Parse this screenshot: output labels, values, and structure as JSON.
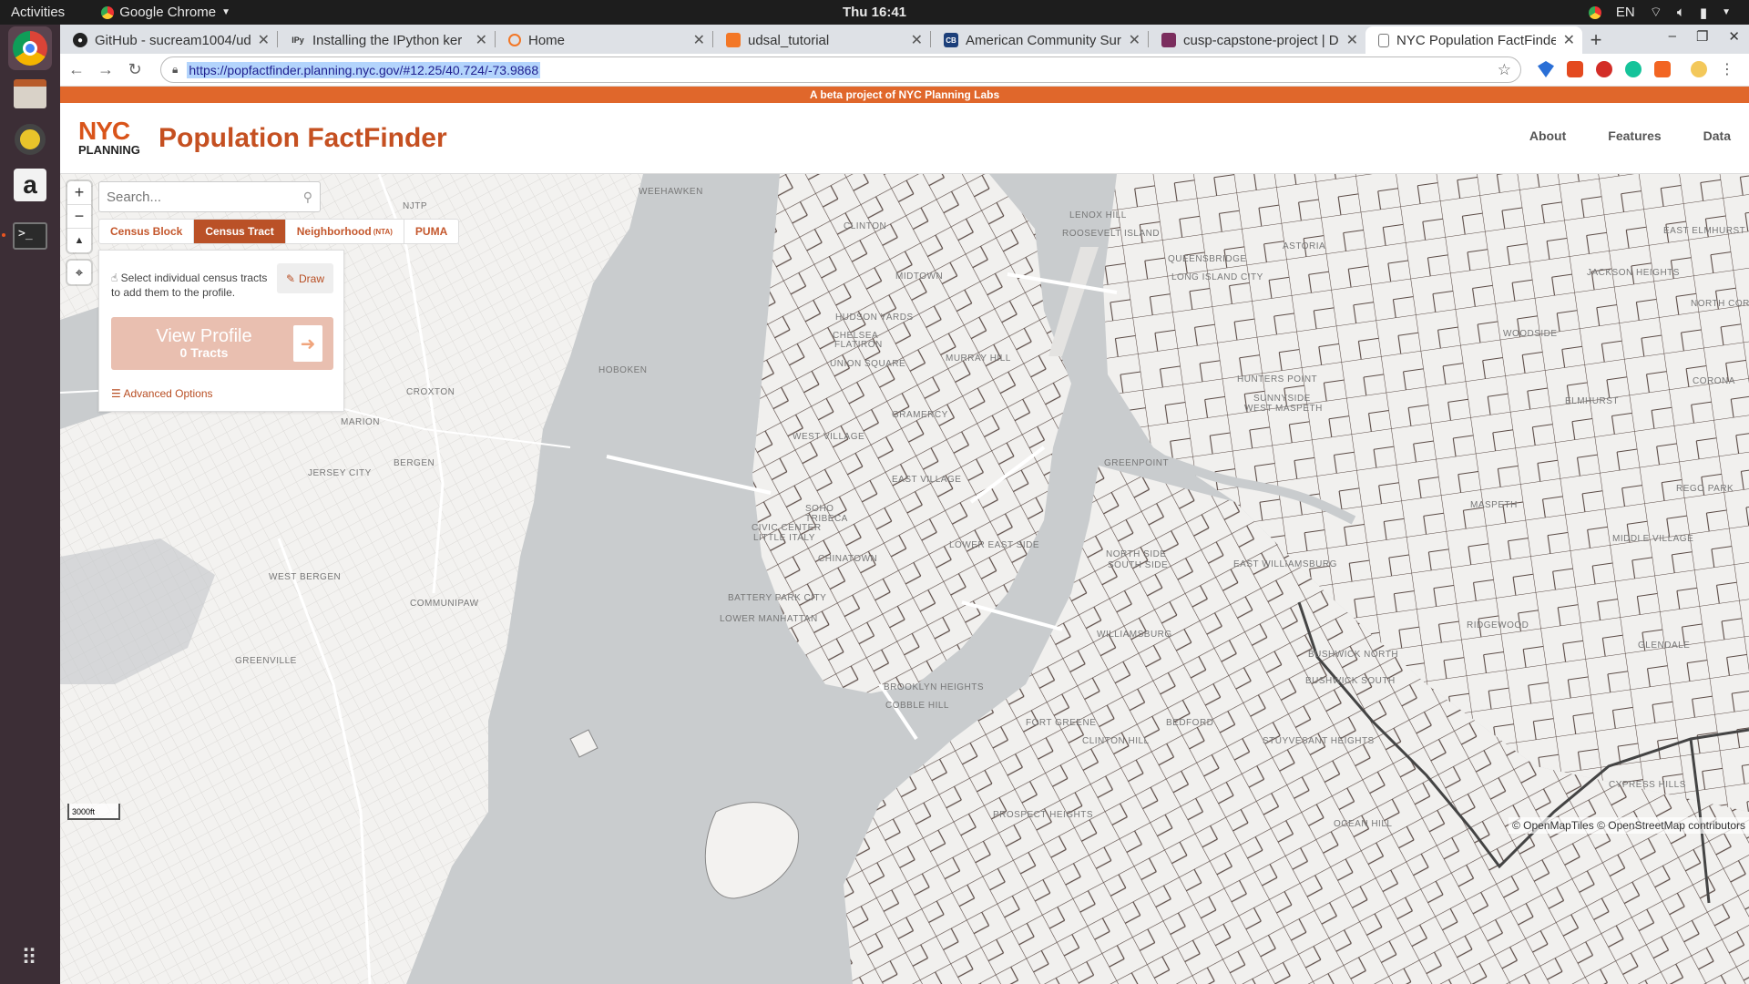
{
  "os": {
    "activities": "Activities",
    "app_name": "Google Chrome",
    "clock": "Thu 16:41",
    "lang": "EN"
  },
  "browser": {
    "tabs": [
      {
        "title": "GitHub - sucream1004/ud",
        "icon": "github-icon"
      },
      {
        "title": "Installing the IPython ker",
        "icon": "ipython-icon"
      },
      {
        "title": "Home",
        "icon": "jupyter-icon"
      },
      {
        "title": "udsal_tutorial",
        "icon": "notebook-icon"
      },
      {
        "title": "American Community Sur",
        "icon": "census-icon"
      },
      {
        "title": "cusp-capstone-project | D",
        "icon": "project-icon"
      },
      {
        "title": "NYC Population FactFinde",
        "icon": "page-icon"
      }
    ],
    "url": "https://popfactfinder.planning.nyc.gov/#12.25/40.724/-73.9868"
  },
  "site": {
    "beta_banner": "A beta project of NYC Planning Labs",
    "logo_top": "NYC",
    "logo_bottom": "PLANNING",
    "title": "Population FactFinder",
    "nav": [
      "About",
      "Features",
      "Data"
    ]
  },
  "controls": {
    "zoom_in": "+",
    "zoom_out": "−",
    "search_placeholder": "Search...",
    "geo_tabs": [
      {
        "label": "Census Block",
        "suffix": "",
        "active": false
      },
      {
        "label": "Census Tract",
        "suffix": "",
        "active": true
      },
      {
        "label": "Neighborhood",
        "suffix": "(NTA)",
        "active": false
      },
      {
        "label": "PUMA",
        "suffix": "",
        "active": false
      }
    ],
    "instructions": "Select individual census tracts to add them to the profile.",
    "draw_label": "Draw",
    "view_profile": "View Profile",
    "tract_count": "0 Tracts",
    "advanced": "Advanced Options"
  },
  "map": {
    "scale": "3000ft",
    "attribution": "© OpenMapTiles © OpenStreetMap contributors",
    "labels": [
      "WEEHAWKEN",
      "NJTP",
      "HOBOKEN",
      "JERSEY CITY",
      "BERGEN",
      "WEST BERGEN",
      "COMMUNIPAW",
      "GREENVILLE",
      "MARION",
      "CROXTON",
      "CLINTON",
      "MIDTOWN",
      "HUDSON YARDS",
      "CHELSEA",
      "FLATIRON",
      "UNION SQUARE",
      "MURRAY HILL",
      "GRAMERCY",
      "WEST VILLAGE",
      "EAST VILLAGE",
      "SOHO",
      "TRIBECA",
      "CIVIC CENTER",
      "LITTLE ITALY",
      "CHINATOWN",
      "LOWER EAST SIDE",
      "BATTERY PARK CITY",
      "LOWER MANHATTAN",
      "LENOX HILL",
      "ROOSEVELT ISLAND",
      "ASTORIA",
      "QUEENSBRIDGE",
      "LONG ISLAND CITY",
      "HUNTERS POINT",
      "SUNNYSIDE",
      "WEST MASPETH",
      "GREENPOINT",
      "EAST WILLIAMSBURG",
      "NORTH SIDE",
      "SOUTH SIDE",
      "WILLIAMSBURG",
      "BUSHWICK NORTH",
      "BUSHWICK SOUTH",
      "BEDFORD",
      "FORT GREENE",
      "CLINTON HILL",
      "BROOKLYN HEIGHTS",
      "COBBLE HILL",
      "STUYVESANT HEIGHTS",
      "PROSPECT HEIGHTS",
      "JACKSON HEIGHTS",
      "WOODSIDE",
      "ELMHURST",
      "EAST ELMHURST",
      "NORTH CORONA",
      "CORONA",
      "MASPETH",
      "MIDDLE VILLAGE",
      "RIDGEWOOD",
      "GLENDALE",
      "REGO PARK",
      "CYPRESS HILLS",
      "OCEAN HILL"
    ]
  },
  "colors": {
    "brand": "#c55021",
    "banner": "#e0672b",
    "water": "#c9ccce",
    "land": "#f3f2f0",
    "tract_line": "#5a4a45"
  }
}
